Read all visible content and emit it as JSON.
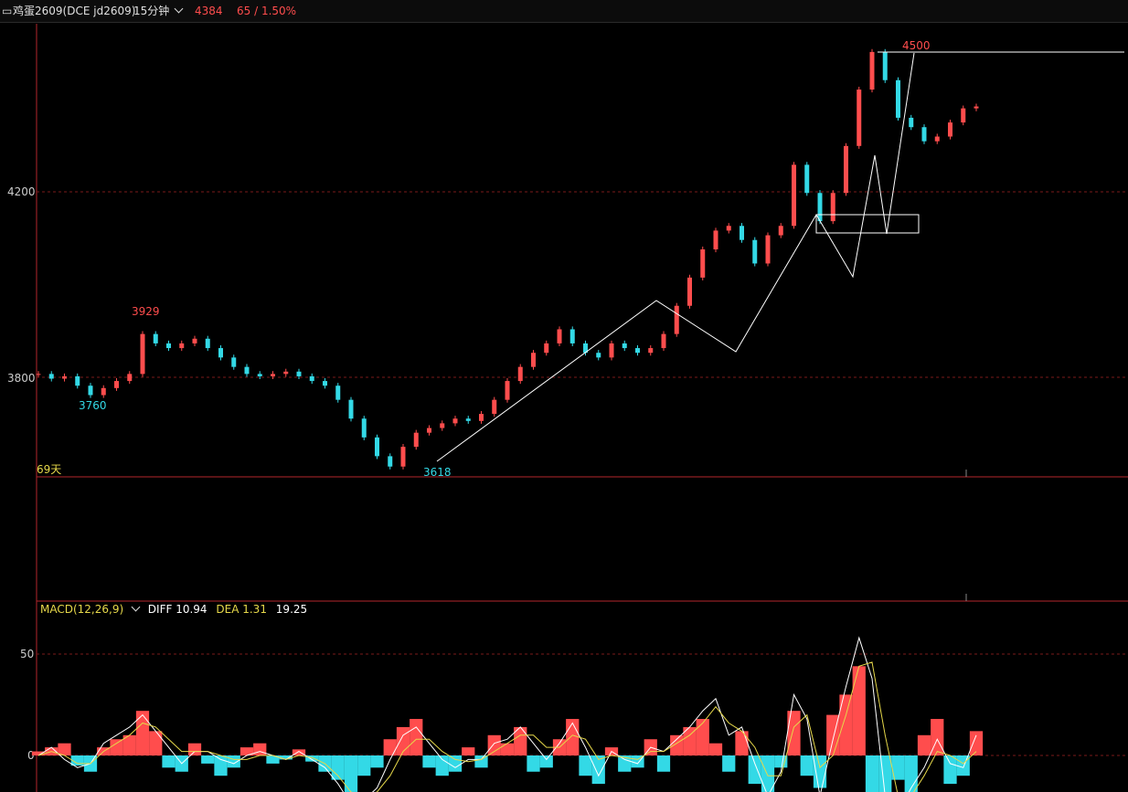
{
  "header": {
    "menu_icon": "menu-icon",
    "symbol": "鸡蛋2609(DCE jd2609)",
    "period": "15分钟",
    "last_price": "4384",
    "change": "65 / 1.50%"
  },
  "colors": {
    "up": "#ff4d4d",
    "down": "#33d9e6",
    "line": "#ffffff",
    "dea": "#e6d84a",
    "grid": "#7a1a1a",
    "pane_border": "#b3262b"
  },
  "price_pane": {
    "range_label": "69天",
    "annotations": {
      "high1": "3929",
      "low1": "3760",
      "low2": "3618",
      "high2": "4500"
    }
  },
  "macd": {
    "label": "MACD(12,26,9)",
    "diff": "DIFF 10.94",
    "dea": "DEA 1.31",
    "macd_value": "19.25"
  },
  "chart_data": [
    {
      "type": "line",
      "title": "",
      "series": [
        {
          "values": [
            3815,
            3805,
            3810,
            3790,
            3770,
            3785,
            3800,
            3815,
            3900,
            3880,
            3870,
            3880,
            3890,
            3870,
            3850,
            3830,
            3815,
            3810,
            3815,
            3820,
            3810,
            3800,
            3790,
            3760,
            3720,
            3680,
            3640,
            3618,
            3660,
            3690,
            3700,
            3710,
            3720,
            3715,
            3730,
            3760,
            3800,
            3830,
            3860,
            3880,
            3910,
            3880,
            3860,
            3850,
            3880,
            3870,
            3860,
            3870,
            3900,
            3960,
            4020,
            4080,
            4120,
            4130,
            4100,
            4050,
            4110,
            4130,
            4260,
            4200,
            4140,
            4200,
            4300,
            4420,
            4500,
            4440,
            4360,
            4340,
            4310,
            4320,
            4350,
            4380,
            4384
          ]
        }
      ],
      "yticks": [
        3800,
        4200
      ],
      "ylim": [
        3600,
        4560
      ]
    },
    {
      "type": "bar",
      "title": "MACD(12,26,9)",
      "series": [
        {
          "name": "MACD",
          "values": [
            2,
            4,
            6,
            -5,
            -8,
            4,
            8,
            10,
            22,
            12,
            -6,
            -8,
            6,
            -4,
            -10,
            -6,
            4,
            6,
            -4,
            -2,
            3,
            -3,
            -8,
            -12,
            -18,
            -10,
            -6,
            8,
            14,
            18,
            -6,
            -10,
            -8,
            4,
            -6,
            10,
            6,
            14,
            -8,
            -6,
            8,
            18,
            -10,
            -14,
            4,
            -8,
            -6,
            8,
            -8,
            10,
            14,
            18,
            6,
            -8,
            12,
            -14,
            -18,
            -6,
            22,
            -10,
            -16,
            20,
            30,
            44,
            -20,
            -30,
            -12,
            -20,
            10,
            18,
            -14,
            -10,
            12
          ]
        },
        {
          "name": "DIFF",
          "values": [
            0,
            4,
            -2,
            -6,
            -4,
            6,
            10,
            14,
            20,
            12,
            4,
            -4,
            2,
            2,
            -2,
            -4,
            0,
            2,
            0,
            -2,
            2,
            -2,
            -6,
            -14,
            -24,
            -22,
            -16,
            -2,
            10,
            14,
            6,
            -2,
            -6,
            -2,
            -2,
            6,
            8,
            14,
            6,
            -2,
            6,
            16,
            4,
            -10,
            2,
            -2,
            -4,
            4,
            2,
            8,
            14,
            22,
            28,
            10,
            14,
            -4,
            -20,
            -8,
            30,
            18,
            -20,
            8,
            34,
            58,
            38,
            -20,
            -28,
            -16,
            -6,
            8,
            -4,
            -6,
            10
          ]
        },
        {
          "name": "DEA",
          "values": [
            0,
            2,
            0,
            -4,
            -4,
            2,
            6,
            10,
            16,
            14,
            8,
            2,
            2,
            2,
            0,
            -2,
            -2,
            0,
            0,
            -2,
            0,
            -1,
            -4,
            -10,
            -18,
            -20,
            -18,
            -10,
            2,
            8,
            8,
            2,
            -2,
            -3,
            -2,
            2,
            6,
            10,
            10,
            4,
            4,
            10,
            8,
            -2,
            0,
            -1,
            -2,
            2,
            2,
            6,
            10,
            16,
            24,
            16,
            12,
            4,
            -10,
            -10,
            14,
            20,
            -6,
            0,
            20,
            44,
            46,
            10,
            -20,
            -20,
            -10,
            2,
            0,
            -4,
            2
          ]
        }
      ],
      "yticks": [
        0,
        50
      ],
      "ylim": [
        -35,
        70
      ]
    }
  ]
}
